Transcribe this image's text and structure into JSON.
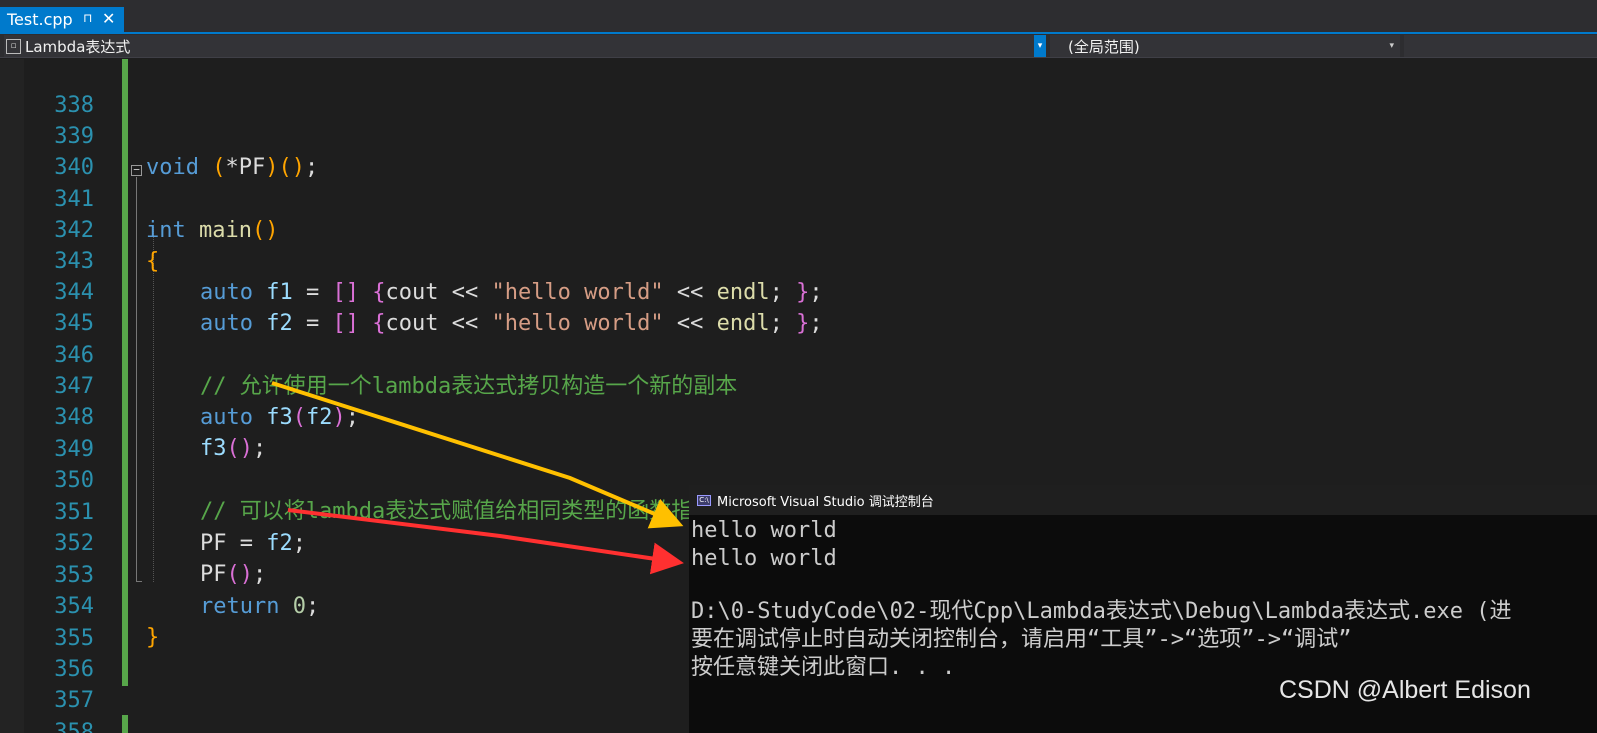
{
  "tab": {
    "filename": "Test.cpp",
    "pin": "⊓",
    "close": "✕"
  },
  "navbar": {
    "project": "Lambda表达式",
    "scope": "(全局范围)"
  },
  "editor": {
    "lines": [
      {
        "n": "338"
      },
      {
        "n": "339",
        "a": "void",
        "b": " ",
        "c": "(",
        "d": "*PF",
        "e": ")",
        "f": "()",
        "g": ";"
      },
      {
        "n": "340"
      },
      {
        "n": "341",
        "a": "int",
        "b": " ",
        "c": "main",
        "d": "()"
      },
      {
        "n": "342",
        "a": "{"
      },
      {
        "n": "343",
        "a": "auto",
        "b": " ",
        "c": "f1",
        "d": " = ",
        "e": "[]",
        "f": " ",
        "g": "{",
        "h": "cout << ",
        "i": "\"hello world\"",
        "j": " << ",
        "k": "endl",
        "l": "; ",
        "m": "}",
        "o": ";"
      },
      {
        "n": "344",
        "a": "auto",
        "b": " ",
        "c": "f2",
        "d": " = ",
        "e": "[]",
        "f": " ",
        "g": "{",
        "h": "cout << ",
        "i": "\"hello world\"",
        "j": " << ",
        "k": "endl",
        "l": "; ",
        "m": "}",
        "o": ";"
      },
      {
        "n": "345"
      },
      {
        "n": "346",
        "a": "// 允许使用一个lambda表达式拷贝构造一个新的副本"
      },
      {
        "n": "347",
        "a": "auto",
        "b": " ",
        "c": "f3",
        "d": "(",
        "e": "f2",
        "f": ")",
        "g": ";"
      },
      {
        "n": "348",
        "a": "f3",
        "b": "()",
        "c": ";"
      },
      {
        "n": "349"
      },
      {
        "n": "350",
        "a": "// 可以将lambda表达式赋值给相同类型的函数指针"
      },
      {
        "n": "351",
        "a": "PF",
        "b": " = ",
        "c": "f2",
        "d": ";"
      },
      {
        "n": "352",
        "a": "PF",
        "b": "()",
        "c": ";"
      },
      {
        "n": "353",
        "a": "return",
        "b": " ",
        "c": "0",
        "d": ";"
      },
      {
        "n": "354",
        "a": "}"
      },
      {
        "n": "355"
      },
      {
        "n": "356"
      },
      {
        "n": "357"
      },
      {
        "n": "358"
      }
    ]
  },
  "console": {
    "title": "Microsoft Visual Studio 调试控制台",
    "icon_text": "C:\\",
    "lines": [
      "hello world",
      "hello world",
      "",
      "D:\\0-StudyCode\\02-现代Cpp\\Lambda表达式\\Debug\\Lambda表达式.exe (进",
      "要在调试停止时自动关闭控制台，请启用“工具”->“选项”->“调试”",
      "按任意键关闭此窗口. . ."
    ]
  },
  "watermark": "CSDN @Albert Edison",
  "colors": {
    "accent": "#007acc",
    "keyword": "#569cd6",
    "comment": "#57a64a",
    "string": "#d69d85",
    "arrow_yellow": "#ffc000",
    "arrow_red": "#ff3030"
  }
}
